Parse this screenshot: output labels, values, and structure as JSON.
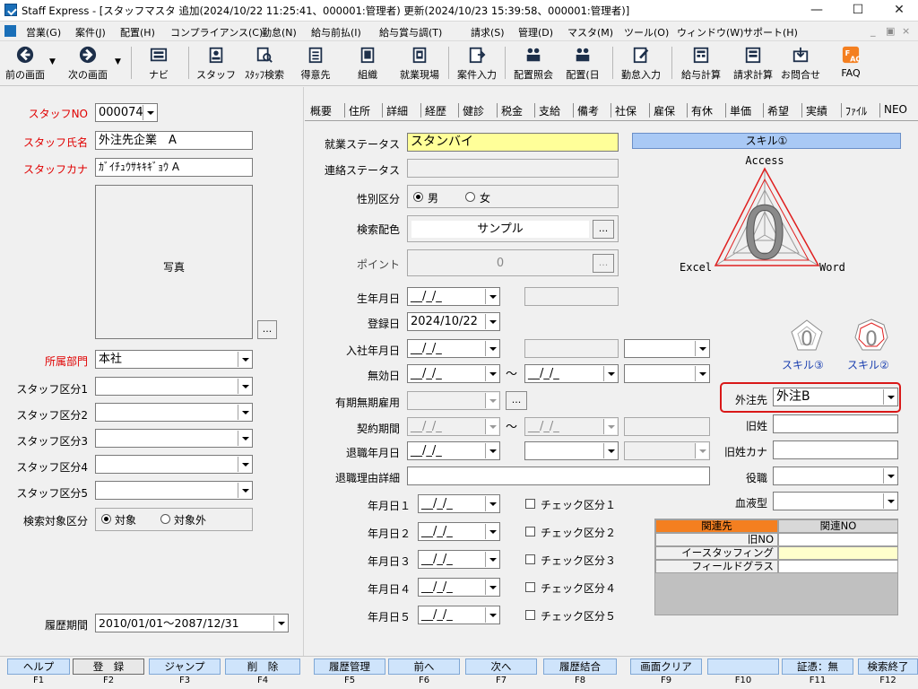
{
  "window": {
    "title": "Staff Express - [スタッフマスタ 追加(2024/10/22 11:25:41、000001:管理者) 更新(2024/10/23 15:39:58、000001:管理者)]"
  },
  "menu": [
    "営業(G)",
    "案件(J)",
    "配置(H)",
    "コンプライアンス(C)",
    "勤怠(N)",
    "給与前払(I)",
    "給与賞与調(T)",
    "請求(S)",
    "管理(D)",
    "マスタ(M)",
    "ツール(O)",
    "ウィンドウ(W)",
    "サポート(H)"
  ],
  "toolbar": {
    "prev": "前の画面",
    "next": "次の画面",
    "navi": "ナビ",
    "staff": "スタッフ",
    "staff_search": "ｽﾀｯﾌ検索",
    "client": "得意先",
    "org": "組織",
    "site": "就業現場",
    "case_entry": "案件入力",
    "placement_inquiry": "配置照会",
    "placement": "配置(日",
    "attendance": "勤怠入力",
    "payroll": "給与計算",
    "billing": "請求計算",
    "contact": "お問合せ",
    "faq": "FAQ"
  },
  "left": {
    "staff_no_label": "スタッフNO",
    "staff_no": "000074",
    "staff_name_label": "スタッフ氏名",
    "staff_name": "外注先企業　A",
    "staff_kana_label": "スタッフカナ",
    "staff_kana": "ｶﾞｲﾁｭｳｻｷｷｷﾞｮｳ A",
    "photo_label": "写真",
    "photo_button": "...",
    "dept_label": "所属部門",
    "dept_value": "本社",
    "kubun_labels": [
      "スタッフ区分1",
      "スタッフ区分2",
      "スタッフ区分3",
      "スタッフ区分4",
      "スタッフ区分5"
    ],
    "search_target_label": "検索対象区分",
    "search_target_options": [
      "対象",
      "対象外"
    ],
    "history_label": "履歴期間",
    "history_value": "2010/01/01～2087/12/31"
  },
  "tabs": [
    "概要",
    "住所",
    "詳細",
    "経歴",
    "健診",
    "税金",
    "支給",
    "備考",
    "社保",
    "雇保",
    "有休",
    "単価",
    "希望",
    "実績",
    "ﾌｧｲﾙ",
    "NEO"
  ],
  "form": {
    "employment_status_label": "就業ステータス",
    "employment_status": "スタンバイ",
    "contact_status_label": "連絡ステータス",
    "gender_label": "性別区分",
    "gender_options": [
      "男",
      "女"
    ],
    "search_color_label": "検索配色",
    "search_color_value": "サンプル",
    "points_label": "ポイント",
    "points_value": "0",
    "birth_label": "生年月日",
    "reg_label": "登録日",
    "reg_value": "2024/10/22",
    "join_label": "入社年月日",
    "invalid_label": "無効日",
    "contract_type_label": "有期無期雇用",
    "contract_period_label": "契約期間",
    "retire_label": "退職年月日",
    "retire_reason_label": "退職理由詳細",
    "date_empty": "__/_/_",
    "tilde": "～",
    "ellipsis": "...",
    "date_rows": [
      "年月日１",
      "年月日２",
      "年月日３",
      "年月日４",
      "年月日５"
    ],
    "check_labels": [
      "チェック区分１",
      "チェック区分２",
      "チェック区分３",
      "チェック区分４",
      "チェック区分５"
    ]
  },
  "right": {
    "skill_header": "スキル①",
    "radar_labels": {
      "top": "Access",
      "left": "Excel",
      "right": "Word"
    },
    "radar_value": "0",
    "skill3": "スキル③",
    "skill2": "スキル②",
    "mini_value": "0",
    "outsource_label": "外注先",
    "outsource_value": "外注B",
    "old_name_label": "旧姓",
    "old_kana_label": "旧姓カナ",
    "position_label": "役職",
    "blood_label": "血液型",
    "grid_headers": [
      "関連先",
      "関連NO"
    ],
    "grid_rows": [
      {
        "name": "旧NO",
        "no": ""
      },
      {
        "name": "イースタッフィング",
        "no": ""
      },
      {
        "name": "フィールドグラス",
        "no": ""
      }
    ]
  },
  "fkeys": [
    {
      "label": "ヘルプ",
      "key": "F1"
    },
    {
      "label": "登　録",
      "key": "F2"
    },
    {
      "label": "ジャンプ",
      "key": "F3"
    },
    {
      "label": "削　除",
      "key": "F4"
    },
    {
      "label": "履歴管理",
      "key": "F5"
    },
    {
      "label": "前へ",
      "key": "F6"
    },
    {
      "label": "次へ",
      "key": "F7"
    },
    {
      "label": "履歴結合",
      "key": "F8"
    },
    {
      "label": "画面クリア",
      "key": "F9"
    },
    {
      "label": "",
      "key": "F10"
    },
    {
      "label": "証憑：無",
      "key": "F11"
    },
    {
      "label": "検索終了",
      "key": "F12"
    }
  ],
  "colors": {
    "required_label": "#e00000",
    "status_yellow": "#ffff99",
    "skill_header_blue": "#a9c9f5",
    "grid_header_orange": "#f47f20",
    "highlight_border": "#d91818",
    "radar_red": "#e02020"
  }
}
